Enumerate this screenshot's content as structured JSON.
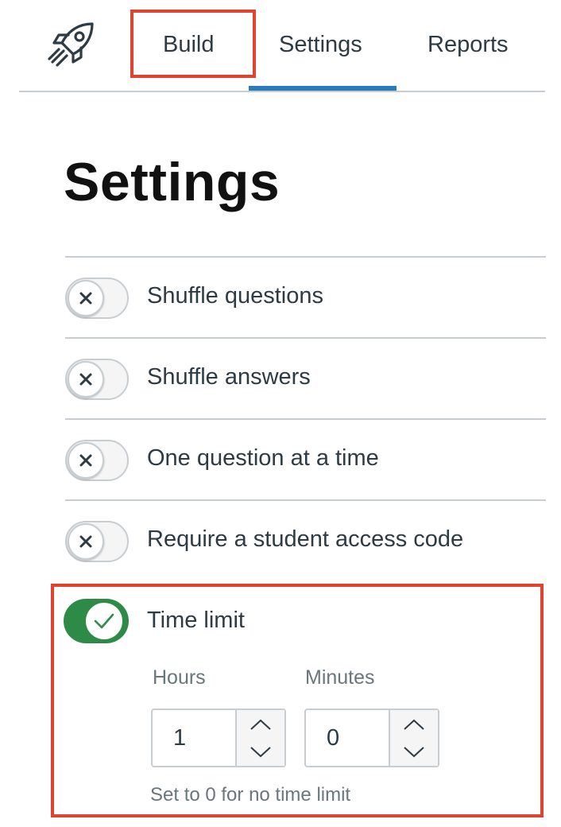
{
  "nav": {
    "logo_icon": "rocket-icon",
    "tabs": [
      {
        "label": "Build"
      },
      {
        "label": "Settings",
        "active": true
      },
      {
        "label": "Reports"
      }
    ]
  },
  "page": {
    "title": "Settings"
  },
  "settings": [
    {
      "label": "Shuffle questions",
      "enabled": false
    },
    {
      "label": "Shuffle answers",
      "enabled": false
    },
    {
      "label": "One question at a time",
      "enabled": false
    },
    {
      "label": "Require a student access code",
      "enabled": false
    }
  ],
  "time_limit": {
    "label": "Time limit",
    "enabled": true,
    "hours_label": "Hours",
    "hours_value": "1",
    "minutes_label": "Minutes",
    "minutes_value": "0",
    "hint": "Set to 0 for no time limit"
  },
  "colors": {
    "accent_blue": "#2b7abc",
    "toggle_on_green": "#2e8b47",
    "highlight_red": "#e2432f"
  }
}
